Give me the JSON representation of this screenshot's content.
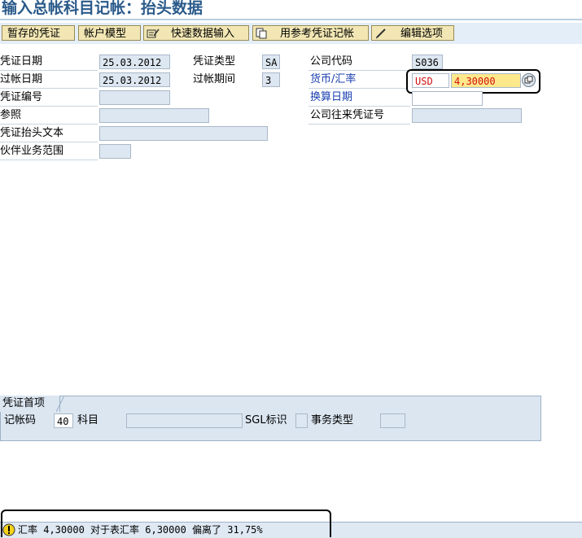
{
  "title": "输入总帐科目记帐：抬头数据",
  "toolbar": {
    "parked_doc": "暂存的凭证",
    "account_model": "帐户模型",
    "fast_entry": "快速数据输入",
    "post_with_ref": "用参考凭证记帐",
    "edit_options": "编辑选项"
  },
  "header": {
    "doc_date_label": "凭证日期",
    "doc_date": "25.03.2012",
    "doc_type_label": "凭证类型",
    "doc_type": "SA",
    "company_code_label": "公司代码",
    "company_code": "S036",
    "posting_date_label": "过帐日期",
    "posting_date": "25.03.2012",
    "period_label": "过帐期间",
    "period": "3",
    "currency_rate_label": "货币/汇率",
    "currency": "USD",
    "exchange_rate": "4,30000",
    "doc_number_label": "凭证编号",
    "doc_number": "",
    "translation_date_label": "换算日期",
    "translation_date": "",
    "reference_label": "参照",
    "reference": "",
    "intercompany_label": "公司往来凭证号",
    "intercompany": "",
    "header_text_label": "凭证抬头文本",
    "header_text": "",
    "trading_partner_label": "伙伴业务范围",
    "trading_partner": ""
  },
  "first_item": {
    "tab_label": "凭证首项",
    "posting_key_label": "记帐码",
    "posting_key": "40",
    "account_label": "科目",
    "account": "",
    "sgl_label": "SGL标识",
    "sgl": "",
    "trans_type_label": "事务类型",
    "trans_type": ""
  },
  "status": {
    "message": "汇率 4,30000 对于表汇率 6,30000 偏离了 31,75%"
  }
}
